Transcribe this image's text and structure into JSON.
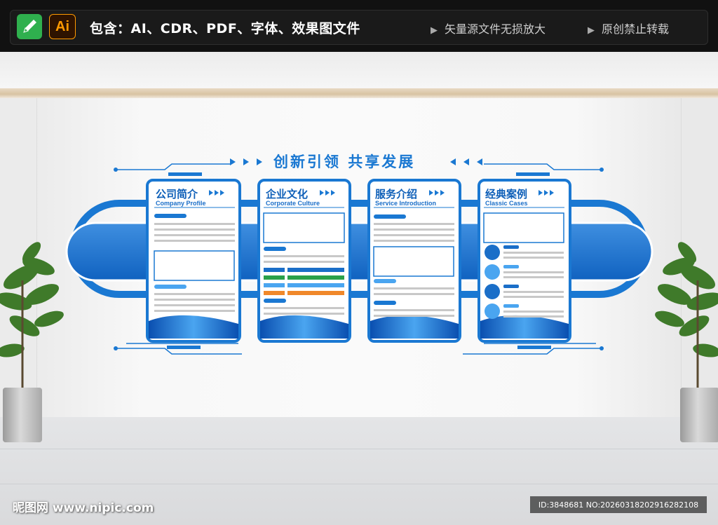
{
  "banner": {
    "ai_badge": "Ai",
    "includes_text": "包含：AI、CDR、PDF、字体、效果图文件",
    "note_vector": "矢量源文件无损放大",
    "note_original": "原创禁止转载"
  },
  "display": {
    "slogan": "创新引领  共享发展",
    "accent_color": "#1a78d2",
    "cards": [
      {
        "title": "公司简介",
        "subtitle": "Company Profile"
      },
      {
        "title": "企业文化",
        "subtitle": "Corporate Culture"
      },
      {
        "title": "服务介绍",
        "subtitle": "Service Introduction"
      },
      {
        "title": "经典案例",
        "subtitle": "Classic Cases"
      }
    ]
  },
  "watermark": {
    "site": "昵图网 www.nipic.com",
    "id_text": "ID:3848681 NO:20260318202916282108"
  }
}
